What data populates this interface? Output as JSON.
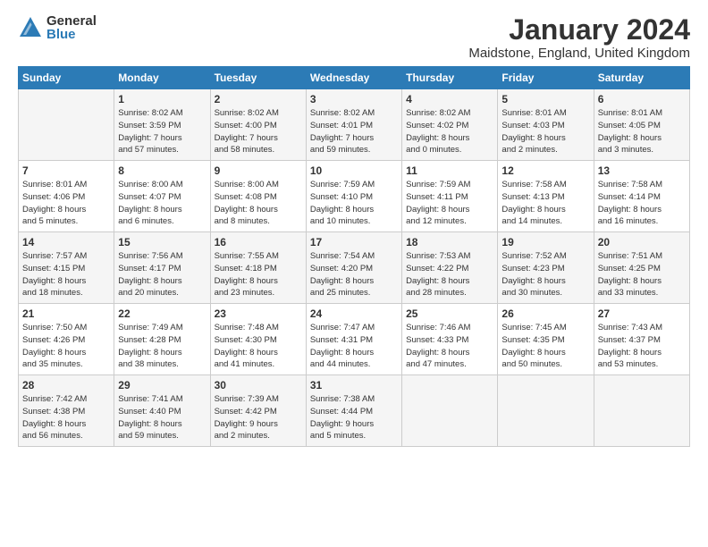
{
  "logo": {
    "general": "General",
    "blue": "Blue"
  },
  "title": "January 2024",
  "subtitle": "Maidstone, England, United Kingdom",
  "days_header": [
    "Sunday",
    "Monday",
    "Tuesday",
    "Wednesday",
    "Thursday",
    "Friday",
    "Saturday"
  ],
  "weeks": [
    [
      {
        "num": "",
        "info": ""
      },
      {
        "num": "1",
        "info": "Sunrise: 8:02 AM\nSunset: 3:59 PM\nDaylight: 7 hours\nand 57 minutes."
      },
      {
        "num": "2",
        "info": "Sunrise: 8:02 AM\nSunset: 4:00 PM\nDaylight: 7 hours\nand 58 minutes."
      },
      {
        "num": "3",
        "info": "Sunrise: 8:02 AM\nSunset: 4:01 PM\nDaylight: 7 hours\nand 59 minutes."
      },
      {
        "num": "4",
        "info": "Sunrise: 8:02 AM\nSunset: 4:02 PM\nDaylight: 8 hours\nand 0 minutes."
      },
      {
        "num": "5",
        "info": "Sunrise: 8:01 AM\nSunset: 4:03 PM\nDaylight: 8 hours\nand 2 minutes."
      },
      {
        "num": "6",
        "info": "Sunrise: 8:01 AM\nSunset: 4:05 PM\nDaylight: 8 hours\nand 3 minutes."
      }
    ],
    [
      {
        "num": "7",
        "info": "Sunrise: 8:01 AM\nSunset: 4:06 PM\nDaylight: 8 hours\nand 5 minutes."
      },
      {
        "num": "8",
        "info": "Sunrise: 8:00 AM\nSunset: 4:07 PM\nDaylight: 8 hours\nand 6 minutes."
      },
      {
        "num": "9",
        "info": "Sunrise: 8:00 AM\nSunset: 4:08 PM\nDaylight: 8 hours\nand 8 minutes."
      },
      {
        "num": "10",
        "info": "Sunrise: 7:59 AM\nSunset: 4:10 PM\nDaylight: 8 hours\nand 10 minutes."
      },
      {
        "num": "11",
        "info": "Sunrise: 7:59 AM\nSunset: 4:11 PM\nDaylight: 8 hours\nand 12 minutes."
      },
      {
        "num": "12",
        "info": "Sunrise: 7:58 AM\nSunset: 4:13 PM\nDaylight: 8 hours\nand 14 minutes."
      },
      {
        "num": "13",
        "info": "Sunrise: 7:58 AM\nSunset: 4:14 PM\nDaylight: 8 hours\nand 16 minutes."
      }
    ],
    [
      {
        "num": "14",
        "info": "Sunrise: 7:57 AM\nSunset: 4:15 PM\nDaylight: 8 hours\nand 18 minutes."
      },
      {
        "num": "15",
        "info": "Sunrise: 7:56 AM\nSunset: 4:17 PM\nDaylight: 8 hours\nand 20 minutes."
      },
      {
        "num": "16",
        "info": "Sunrise: 7:55 AM\nSunset: 4:18 PM\nDaylight: 8 hours\nand 23 minutes."
      },
      {
        "num": "17",
        "info": "Sunrise: 7:54 AM\nSunset: 4:20 PM\nDaylight: 8 hours\nand 25 minutes."
      },
      {
        "num": "18",
        "info": "Sunrise: 7:53 AM\nSunset: 4:22 PM\nDaylight: 8 hours\nand 28 minutes."
      },
      {
        "num": "19",
        "info": "Sunrise: 7:52 AM\nSunset: 4:23 PM\nDaylight: 8 hours\nand 30 minutes."
      },
      {
        "num": "20",
        "info": "Sunrise: 7:51 AM\nSunset: 4:25 PM\nDaylight: 8 hours\nand 33 minutes."
      }
    ],
    [
      {
        "num": "21",
        "info": "Sunrise: 7:50 AM\nSunset: 4:26 PM\nDaylight: 8 hours\nand 35 minutes."
      },
      {
        "num": "22",
        "info": "Sunrise: 7:49 AM\nSunset: 4:28 PM\nDaylight: 8 hours\nand 38 minutes."
      },
      {
        "num": "23",
        "info": "Sunrise: 7:48 AM\nSunset: 4:30 PM\nDaylight: 8 hours\nand 41 minutes."
      },
      {
        "num": "24",
        "info": "Sunrise: 7:47 AM\nSunset: 4:31 PM\nDaylight: 8 hours\nand 44 minutes."
      },
      {
        "num": "25",
        "info": "Sunrise: 7:46 AM\nSunset: 4:33 PM\nDaylight: 8 hours\nand 47 minutes."
      },
      {
        "num": "26",
        "info": "Sunrise: 7:45 AM\nSunset: 4:35 PM\nDaylight: 8 hours\nand 50 minutes."
      },
      {
        "num": "27",
        "info": "Sunrise: 7:43 AM\nSunset: 4:37 PM\nDaylight: 8 hours\nand 53 minutes."
      }
    ],
    [
      {
        "num": "28",
        "info": "Sunrise: 7:42 AM\nSunset: 4:38 PM\nDaylight: 8 hours\nand 56 minutes."
      },
      {
        "num": "29",
        "info": "Sunrise: 7:41 AM\nSunset: 4:40 PM\nDaylight: 8 hours\nand 59 minutes."
      },
      {
        "num": "30",
        "info": "Sunrise: 7:39 AM\nSunset: 4:42 PM\nDaylight: 9 hours\nand 2 minutes."
      },
      {
        "num": "31",
        "info": "Sunrise: 7:38 AM\nSunset: 4:44 PM\nDaylight: 9 hours\nand 5 minutes."
      },
      {
        "num": "",
        "info": ""
      },
      {
        "num": "",
        "info": ""
      },
      {
        "num": "",
        "info": ""
      }
    ]
  ]
}
